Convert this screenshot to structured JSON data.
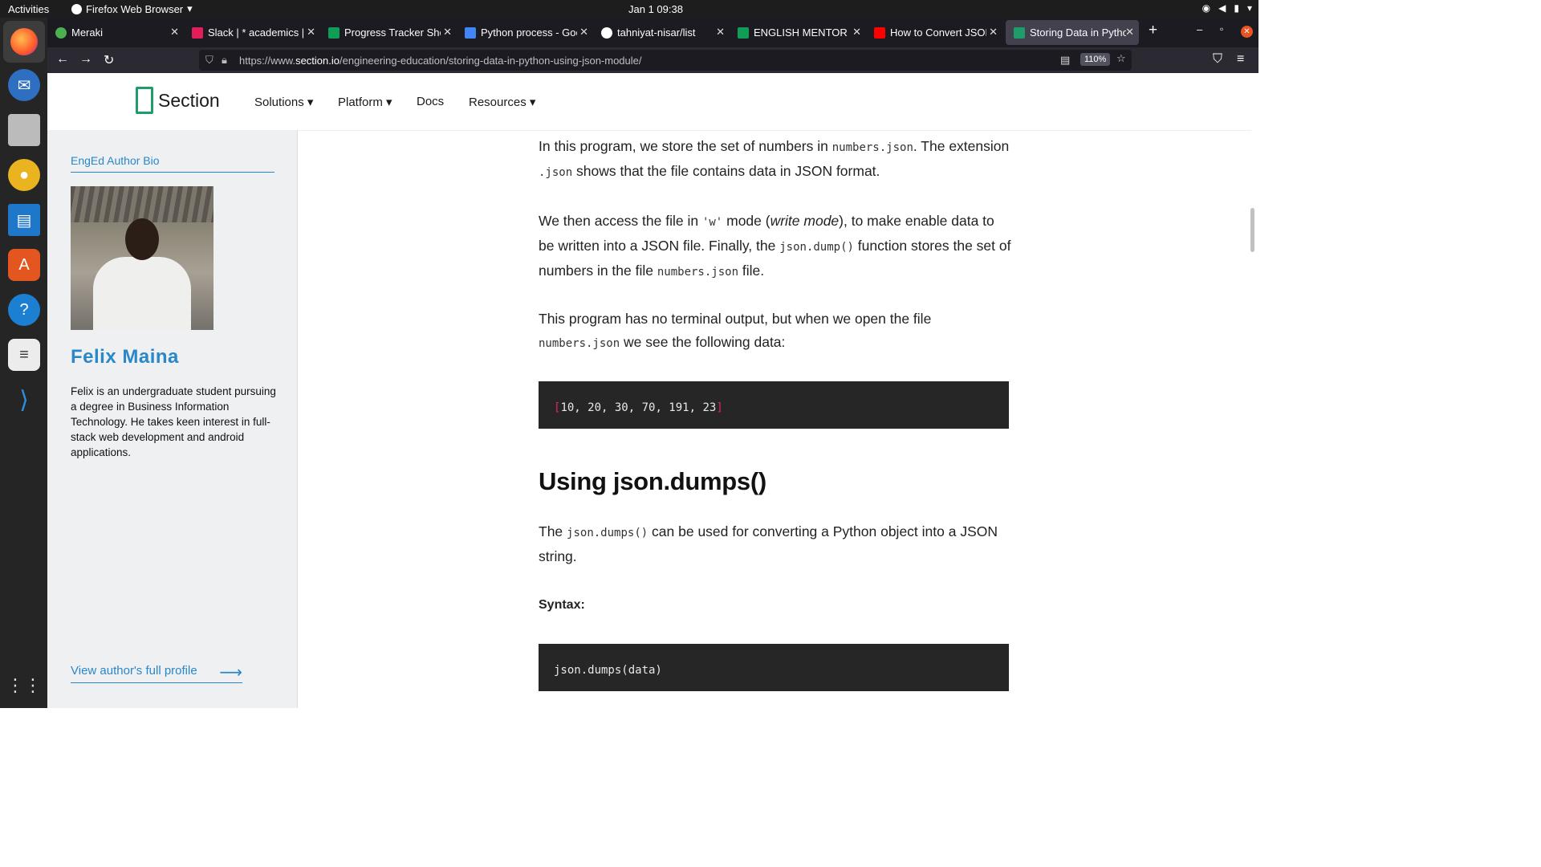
{
  "os": {
    "activities": "Activities",
    "app_name": "Firefox Web Browser",
    "clock": "Jan 1  09:38"
  },
  "tabs": [
    {
      "label": "Meraki",
      "color": "#4caf50"
    },
    {
      "label": "Slack | * academics | N",
      "color": "#e01e5a"
    },
    {
      "label": "Progress Tracker Shee",
      "color": "#0f9d58"
    },
    {
      "label": "Python process - Goog",
      "color": "#4285f4"
    },
    {
      "label": "tahniyat-nisar/list",
      "color": "#ffffff"
    },
    {
      "label": "ENGLISH MENTOR GR",
      "color": "#0f9d58"
    },
    {
      "label": "How to Convert JSON",
      "color": "#ff0000"
    },
    {
      "label": "Storing Data in Python",
      "color": "#1e9d6a"
    }
  ],
  "url": {
    "prefix": "https://www.",
    "domain": "section.io",
    "path": "/engineering-education/storing-data-in-python-using-json-module/",
    "zoom": "110%"
  },
  "site": {
    "logo": "Section",
    "menu": [
      "Solutions ▾",
      "Platform ▾",
      "Docs",
      "Resources ▾"
    ]
  },
  "sidebar": {
    "heading": "EngEd Author Bio",
    "author": "Felix Maina",
    "bio": "Felix is an undergraduate student pursuing a degree in Business Information Technology. He takes keen interest in full-stack web development and android applications.",
    "profile_link": "View author's full profile"
  },
  "article": {
    "p1": [
      "In this program, we store the set of numbers in ",
      "numbers.json",
      ". The extension ",
      ".json",
      " shows that the file contains data in JSON format."
    ],
    "p2": [
      "We then access the file in ",
      "'w'",
      " mode (",
      "write mode",
      "), to make enable data to be written into a JSON file. Finally, the ",
      "json.dump()",
      " function stores the set of numbers in the file ",
      "numbers.json",
      " file."
    ],
    "p3": [
      "This program has no terminal output, but when we open the file ",
      "numbers.json",
      " we see the following data:"
    ],
    "code1": {
      "open": "[",
      "body": "10, 20, 30, 70, 191, 23",
      "close": "]"
    },
    "heading": "Using json.dumps()",
    "p4": [
      "The ",
      "json.dumps()",
      " can be used for converting a Python object into a JSON string."
    ],
    "syntax_label": "Syntax:",
    "code2": "json.dumps(data)"
  }
}
